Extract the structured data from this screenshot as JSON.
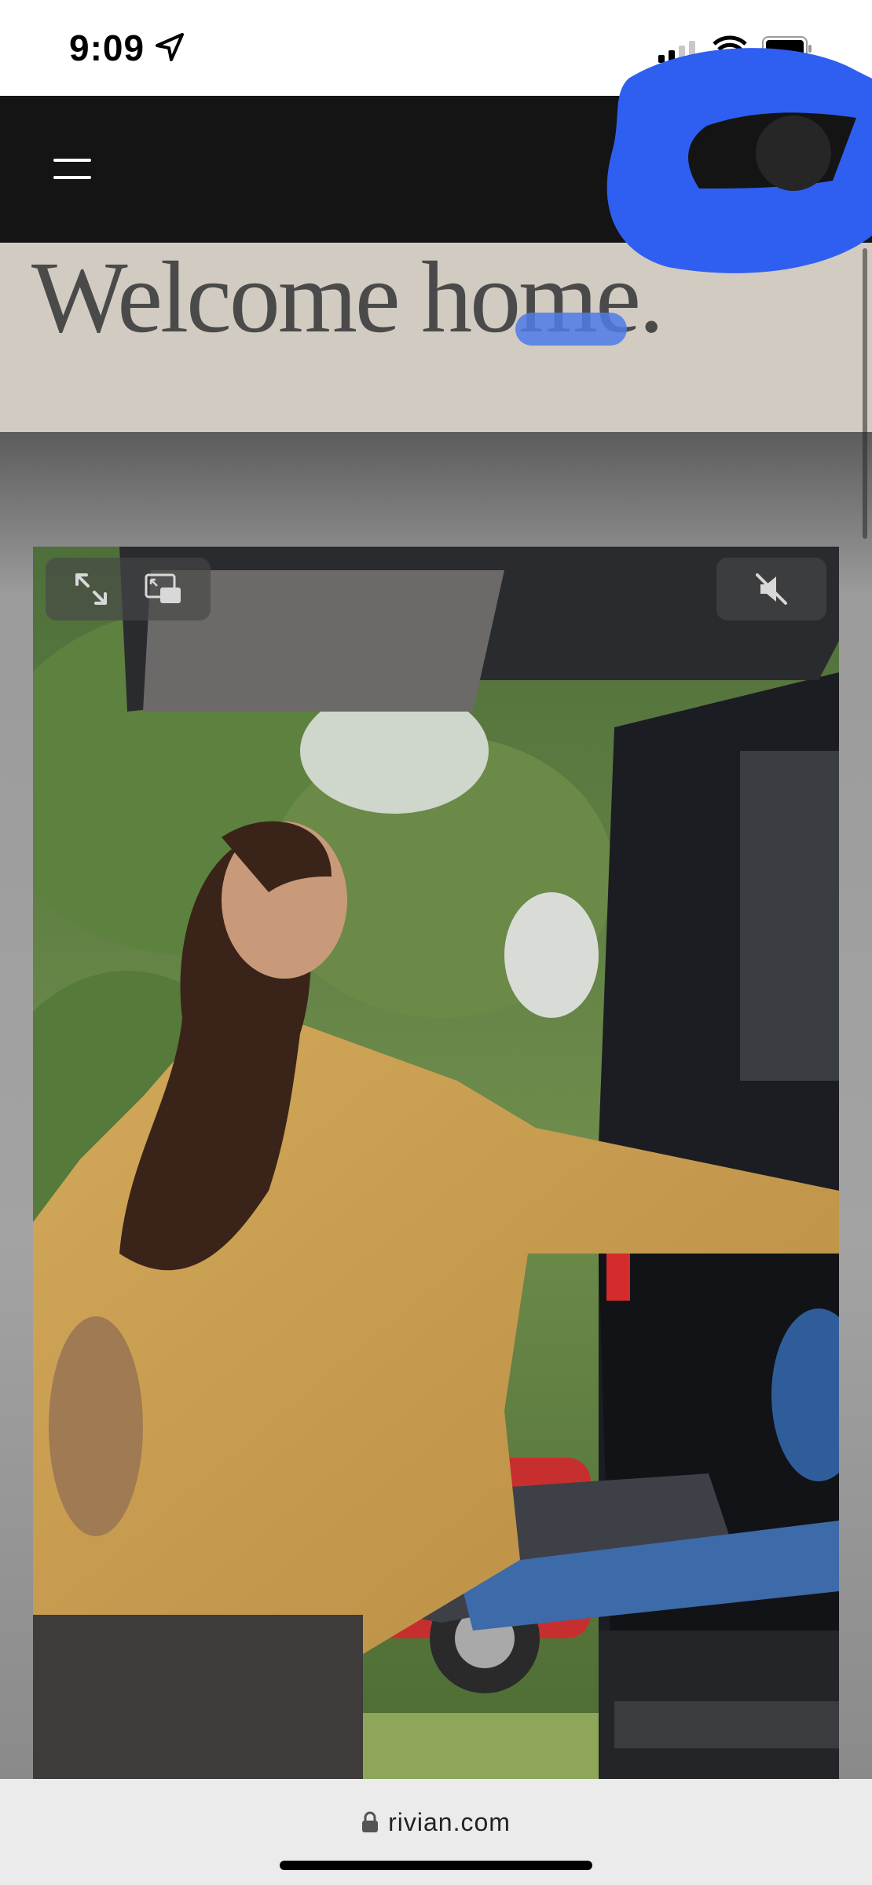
{
  "status_bar": {
    "time": "9:09",
    "icons": [
      "location-arrow-icon",
      "cellular-signal-icon",
      "wifi-icon",
      "battery-icon"
    ]
  },
  "nav": {
    "menu_icon": "hamburger-menu-icon",
    "help_label": "?"
  },
  "hero": {
    "title": "Welcome home."
  },
  "video": {
    "controls": [
      "fullscreen-icon",
      "picture-in-picture-icon",
      "mute-icon"
    ]
  },
  "browser": {
    "url": "rivian.com"
  },
  "colors": {
    "nav_bg": "#141414",
    "hero_bg": "#d2cbc1",
    "scribble": "#2f5ff0",
    "url_bar_bg": "#ebebeb"
  }
}
